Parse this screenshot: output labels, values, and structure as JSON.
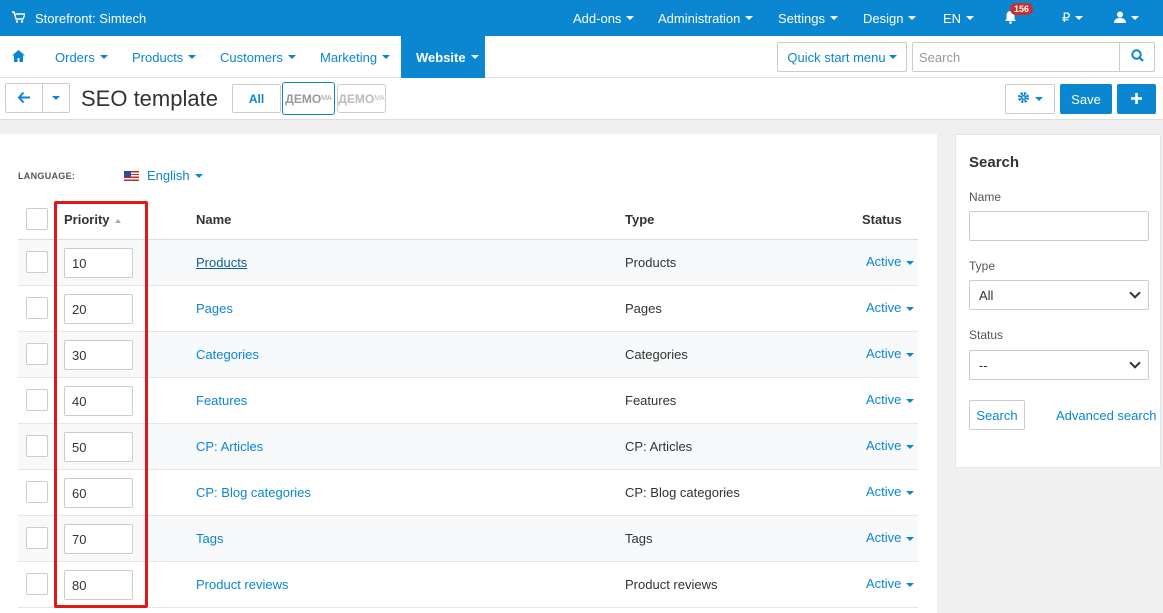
{
  "topbar": {
    "store_label": "Storefront: Simtech",
    "menus": [
      "Add-ons",
      "Administration",
      "Settings",
      "Design",
      "EN"
    ],
    "notifications_count": "156",
    "currency": "₽"
  },
  "nav": {
    "items": [
      "Orders",
      "Products",
      "Customers",
      "Marketing",
      "Website"
    ],
    "active": "Website",
    "quick_start": "Quick start menu",
    "search_placeholder": "Search"
  },
  "titlebar": {
    "title": "SEO template",
    "filter_all": "All",
    "demo_label": "ДЕМО",
    "demo_suffix": "MA",
    "save": "Save"
  },
  "main": {
    "language_label": "LANGUAGE:",
    "language_value": "English",
    "columns": {
      "priority": "Priority",
      "name": "Name",
      "type": "Type",
      "status": "Status"
    },
    "rows": [
      {
        "priority": "10",
        "name": "Products",
        "type": "Products",
        "status": "Active"
      },
      {
        "priority": "20",
        "name": "Pages",
        "type": "Pages",
        "status": "Active"
      },
      {
        "priority": "30",
        "name": "Categories",
        "type": "Categories",
        "status": "Active"
      },
      {
        "priority": "40",
        "name": "Features",
        "type": "Features",
        "status": "Active"
      },
      {
        "priority": "50",
        "name": "CP: Articles",
        "type": "CP: Articles",
        "status": "Active"
      },
      {
        "priority": "60",
        "name": "CP: Blog categories",
        "type": "CP: Blog categories",
        "status": "Active"
      },
      {
        "priority": "70",
        "name": "Tags",
        "type": "Tags",
        "status": "Active"
      },
      {
        "priority": "80",
        "name": "Product reviews",
        "type": "Product reviews",
        "status": "Active"
      }
    ]
  },
  "sidebar": {
    "title": "Search",
    "name_label": "Name",
    "type_label": "Type",
    "type_value": "All",
    "status_label": "Status",
    "status_value": "--",
    "search_button": "Search",
    "advanced_search": "Advanced search"
  },
  "colors": {
    "accent": "#0b86d1",
    "highlight": "#e01818"
  }
}
